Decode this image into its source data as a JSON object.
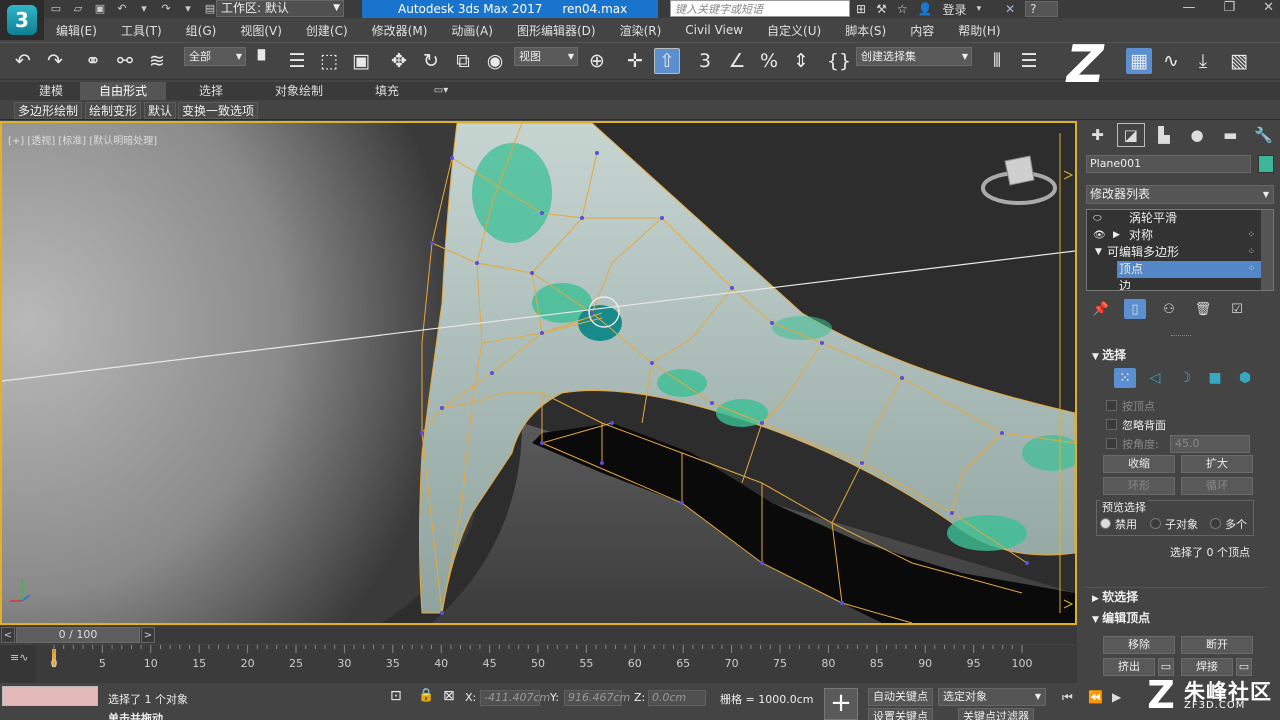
{
  "titlebar": {
    "logo_text": "3",
    "workspace_label": "工作区: 默认",
    "app_name": "Autodesk 3ds Max 2017",
    "file_name": "ren04.max",
    "search_placeholder": "键入关键字或短语",
    "login_label": "登录",
    "help_dropdown": "?"
  },
  "menu": {
    "items": [
      "编辑(E)",
      "工具(T)",
      "组(G)",
      "视图(V)",
      "创建(C)",
      "修改器(M)",
      "动画(A)",
      "图形编辑器(D)",
      "渲染(R)",
      "Civil View",
      "自定义(U)",
      "脚本(S)",
      "内容",
      "帮助(H)"
    ]
  },
  "toolbar": {
    "filter_dropdown": "全部",
    "refcoord_dropdown": "视图",
    "named_selection": "创建选择集"
  },
  "ribbon": {
    "tabs": [
      "建模",
      "自由形式",
      "选择",
      "对象绘制",
      "填充"
    ],
    "active_tab": "自由形式",
    "subtabs": [
      "多边形绘制",
      "绘制变形",
      "默认",
      "变换一致选项"
    ]
  },
  "viewport": {
    "label": "[+] [透视] [标准] [默认明暗处理]"
  },
  "command_panel": {
    "object_name": "Plane001",
    "object_color": "#3fb69a",
    "modifier_list": "修改器列表",
    "stack": [
      {
        "label": "涡轮平滑",
        "indent": 1
      },
      {
        "label": "对称",
        "indent": 1
      },
      {
        "label": "可编辑多边形",
        "indent": 0
      },
      {
        "label": "顶点",
        "indent": 2,
        "selected": true
      },
      {
        "label": "边",
        "indent": 2
      }
    ],
    "selection_rollout": {
      "title": "选择",
      "by_vertex": "按顶点",
      "ignore_backfacing": "忽略背面",
      "by_angle": "按角度:",
      "angle_value": "45.0",
      "shrink": "收缩",
      "grow": "扩大",
      "ring": "环形",
      "loop": "循环",
      "preview_title": "预览选择",
      "preview_options": [
        "禁用",
        "子对象",
        "多个"
      ],
      "preview_selected": "禁用",
      "status": "选择了 0 个顶点"
    },
    "soft_selection_title": "软选择",
    "edit_vertices": {
      "title": "编辑顶点",
      "remove": "移除",
      "break": "断开",
      "extrude": "挤出",
      "weld": "焊接"
    }
  },
  "timeline": {
    "frame_display": "0 / 100",
    "ticks": [
      0,
      5,
      10,
      15,
      20,
      25,
      30,
      35,
      40,
      45,
      50,
      55,
      60,
      65,
      70,
      75,
      80,
      85,
      90,
      95,
      100
    ]
  },
  "status": {
    "selection_info": "选择了 1 个对象",
    "x_label": "X:",
    "x_value": "-411.407cm",
    "y_label": "Y:",
    "y_value": "916.467cm",
    "z_label": "Z:",
    "z_value": "0.0cm",
    "grid": "栅格 = 1000.0cm",
    "auto_key": "自动关键点",
    "selected_dropdown": "选定对象",
    "set_key": "设置关键点",
    "key_filters": "关键点过滤器",
    "hint": "单击并拖动"
  },
  "watermark": {
    "text": "朱峰社区",
    "url": "ZF3D.COM"
  }
}
